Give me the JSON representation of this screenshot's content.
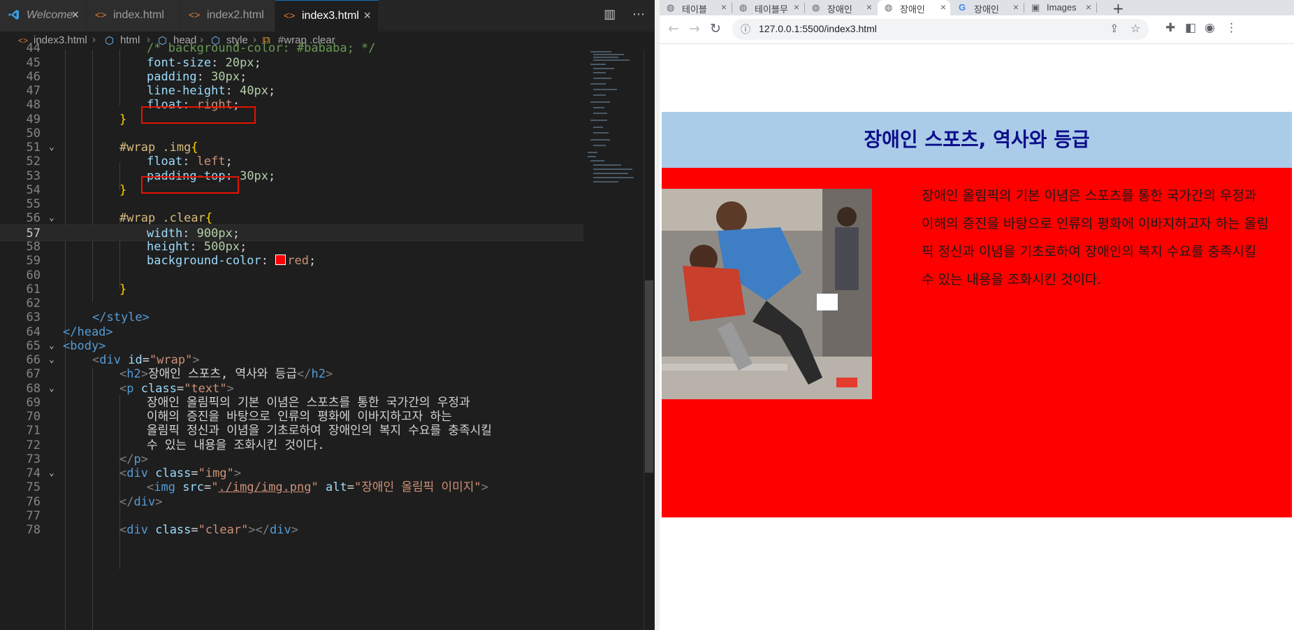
{
  "editor": {
    "tabs": [
      {
        "label": "Welcome",
        "icon": "vscode-logo-icon",
        "italic": true
      },
      {
        "label": "index.html",
        "icon": "html-file-icon"
      },
      {
        "label": "index2.html",
        "icon": "html-file-icon"
      },
      {
        "label": "index3.html",
        "icon": "html-file-icon",
        "active": true
      }
    ],
    "breadcrumb": [
      "index3.html",
      "html",
      "head",
      "style",
      "#wrap .clear"
    ],
    "lines": [
      {
        "n": "44",
        "code": "/* background-color: #bababa; */",
        "fold": false
      },
      {
        "n": "45",
        "code": "font-size: 20px;"
      },
      {
        "n": "46",
        "code": "padding: 30px;"
      },
      {
        "n": "47",
        "code": "line-height: 40px;"
      },
      {
        "n": "48",
        "code": "float: right;"
      },
      {
        "n": "49",
        "code": "}"
      },
      {
        "n": "50",
        "code": ""
      },
      {
        "n": "51",
        "code": "#wrap .img{"
      },
      {
        "n": "52",
        "code": "float: left;"
      },
      {
        "n": "53",
        "code": "padding-top: 30px;"
      },
      {
        "n": "54",
        "code": "}"
      },
      {
        "n": "55",
        "code": ""
      },
      {
        "n": "56",
        "code": "#wrap .clear{"
      },
      {
        "n": "57",
        "code": "width: 900px;"
      },
      {
        "n": "58",
        "code": "height: 500px;"
      },
      {
        "n": "59",
        "code": "background-color: red;"
      },
      {
        "n": "60",
        "code": ""
      },
      {
        "n": "61",
        "code": "}"
      },
      {
        "n": "62",
        "code": ""
      },
      {
        "n": "63",
        "code": "</style>"
      },
      {
        "n": "64",
        "code": "</head>"
      },
      {
        "n": "65",
        "code": "<body>"
      },
      {
        "n": "66",
        "code": "<div id=\"wrap\">"
      },
      {
        "n": "67",
        "code": "<h2>장애인 스포츠, 역사와 등급</h2>"
      },
      {
        "n": "68",
        "code": "<p class=\"text\">"
      },
      {
        "n": "69",
        "code": "장애인 올림픽의 기본 이념은 스포츠를 통한 국가간의 우정과"
      },
      {
        "n": "70",
        "code": "이해의 증진을 바탕으로 인류의 평화에 이바지하고자 하는"
      },
      {
        "n": "71",
        "code": "올림픽 정신과 이념을 기초로하여 장애인의 복지 수요를 충족시킬"
      },
      {
        "n": "72",
        "code": "수 있는 내용을 조화시킨 것이다."
      },
      {
        "n": "73",
        "code": "</p>"
      },
      {
        "n": "74",
        "code": "<div class=\"img\">"
      },
      {
        "n": "75",
        "code": "<img src=\"./img/img.png\" alt=\"장애인 올림픽 이미지\">"
      },
      {
        "n": "76",
        "code": "</div>"
      },
      {
        "n": "77",
        "code": ""
      },
      {
        "n": "78",
        "code": "<div class=\"clear\"></div>"
      }
    ]
  },
  "browser": {
    "tabs": [
      {
        "label": "테이블",
        "icon": "globe-icon"
      },
      {
        "label": "테이블무",
        "icon": "globe-icon"
      },
      {
        "label": "장애인",
        "icon": "globe-icon"
      },
      {
        "label": "장애인",
        "icon": "globe-icon",
        "active": true
      },
      {
        "label": "장애인",
        "icon": "google-icon"
      },
      {
        "label": "Images",
        "icon": "images-icon"
      }
    ],
    "url": "127.0.0.1:5500/index3.html"
  },
  "page": {
    "heading": "장애인 스포츠, 역사와 등급",
    "paragraph": "장애인 올림픽의 기본 이념은 스포츠를 통한 국가간의 우정과 이해의 증진을 바탕으로 인류의 평화에 이바지하고자 하는 올림픽 정신과 이념을 기초로하여 장애인의 복지 수요를 충족시킬 수 있는 내용을 조화시킨 것이다.",
    "image_alt": "장애인 올림픽 이미지"
  },
  "colors": {
    "heading_bg": "#aacce9",
    "heading_text": "#0e0e8a",
    "clear_bg": "#ff0000",
    "highlight_box": "#e51400"
  }
}
